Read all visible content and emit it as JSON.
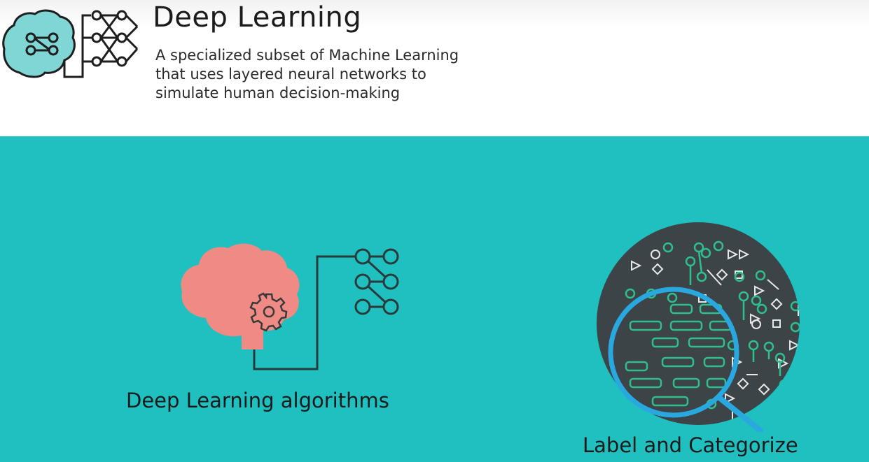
{
  "header": {
    "title": "Deep Learning",
    "subtitle_lines": [
      "A specialized subset of Machine Learning",
      "that uses layered neural networks to",
      "simulate human decision-making"
    ]
  },
  "main": {
    "left_label": "Deep Learning algorithms",
    "right_label": "Label and Categorize"
  },
  "colors": {
    "panel_teal": "#1fc0bf",
    "brain_pink": "#f08a84",
    "circle_dark": "#3d4447",
    "magnifier_blue": "#29a8e0",
    "node_green": "#2fbf8f"
  },
  "icons": [
    "brain-network-icon",
    "brain-gear-icon",
    "magnifying-glass-icon"
  ]
}
